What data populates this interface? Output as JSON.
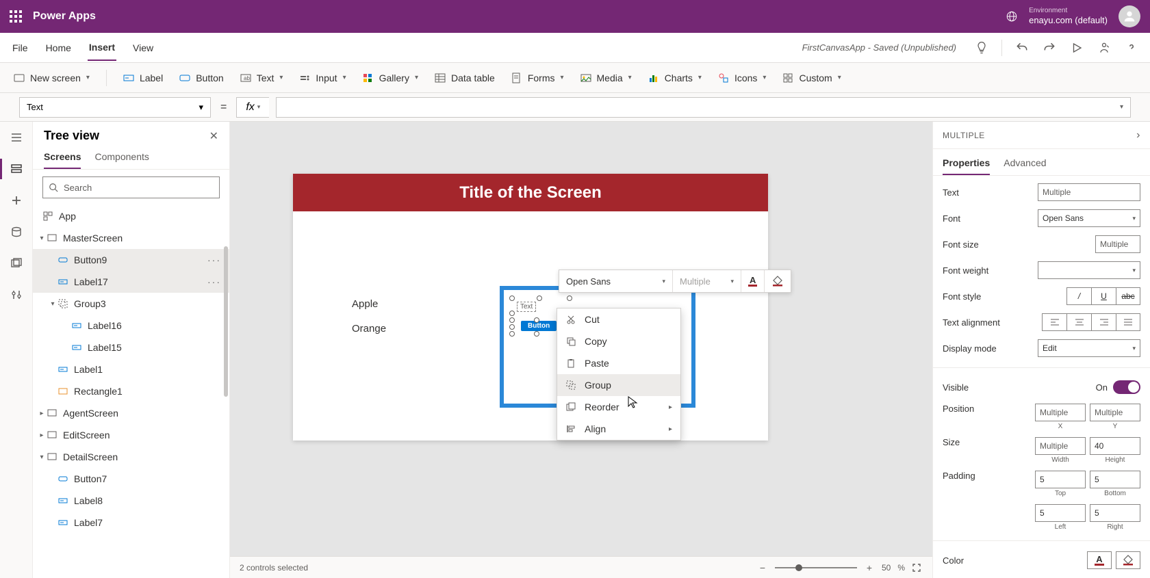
{
  "header": {
    "app_title": "Power Apps",
    "env_label": "Environment",
    "env_value": "enayu.com (default)"
  },
  "menu": {
    "items": [
      "File",
      "Home",
      "Insert",
      "View"
    ],
    "active": "Insert",
    "app_saved": "FirstCanvasApp - Saved (Unpublished)"
  },
  "ribbon": {
    "new_screen": "New screen",
    "label": "Label",
    "button": "Button",
    "text": "Text",
    "input": "Input",
    "gallery": "Gallery",
    "data_table": "Data table",
    "forms": "Forms",
    "media": "Media",
    "charts": "Charts",
    "icons": "Icons",
    "custom": "Custom"
  },
  "formula": {
    "property": "Text",
    "fx": "fx"
  },
  "tree": {
    "title": "Tree view",
    "tab_screens": "Screens",
    "tab_components": "Components",
    "search_placeholder": "Search",
    "items": {
      "app": "App",
      "master": "MasterScreen",
      "button9": "Button9",
      "label17": "Label17",
      "group3": "Group3",
      "label16": "Label16",
      "label15": "Label15",
      "label1": "Label1",
      "rect1": "Rectangle1",
      "agent": "AgentScreen",
      "edit": "EditScreen",
      "detail": "DetailScreen",
      "button7": "Button7",
      "label8": "Label8",
      "label7": "Label7"
    }
  },
  "canvas": {
    "screen_title": "Title of the Screen",
    "fruit1": "Apple",
    "fruit2": "Orange",
    "sel_text": "Text",
    "sel_button": "Button",
    "float_font": "Open Sans",
    "float_size": "Multiple",
    "context": {
      "cut": "Cut",
      "copy": "Copy",
      "paste": "Paste",
      "group": "Group",
      "reorder": "Reorder",
      "align": "Align"
    },
    "footer_status": "2 controls selected",
    "zoom_value": "50",
    "zoom_unit": "%"
  },
  "props": {
    "title": "MULTIPLE",
    "tab_properties": "Properties",
    "tab_advanced": "Advanced",
    "text_label": "Text",
    "text_value": "Multiple",
    "font_label": "Font",
    "font_value": "Open Sans",
    "fontsize_label": "Font size",
    "fontsize_value": "Multiple",
    "fontweight_label": "Font weight",
    "fontstyle_label": "Font style",
    "align_label": "Text alignment",
    "display_label": "Display mode",
    "display_value": "Edit",
    "visible_label": "Visible",
    "visible_state": "On",
    "position_label": "Position",
    "position_x": "Multiple",
    "position_y": "Multiple",
    "x_label": "X",
    "y_label": "Y",
    "size_label": "Size",
    "size_w": "Multiple",
    "size_h": "40",
    "w_label": "Width",
    "h_label": "Height",
    "padding_label": "Padding",
    "pad_top": "5",
    "pad_bottom": "5",
    "top_label": "Top",
    "bottom_label": "Bottom",
    "pad_left": "5",
    "pad_right": "5",
    "left_label": "Left",
    "right_label": "Right",
    "color_label": "Color"
  }
}
